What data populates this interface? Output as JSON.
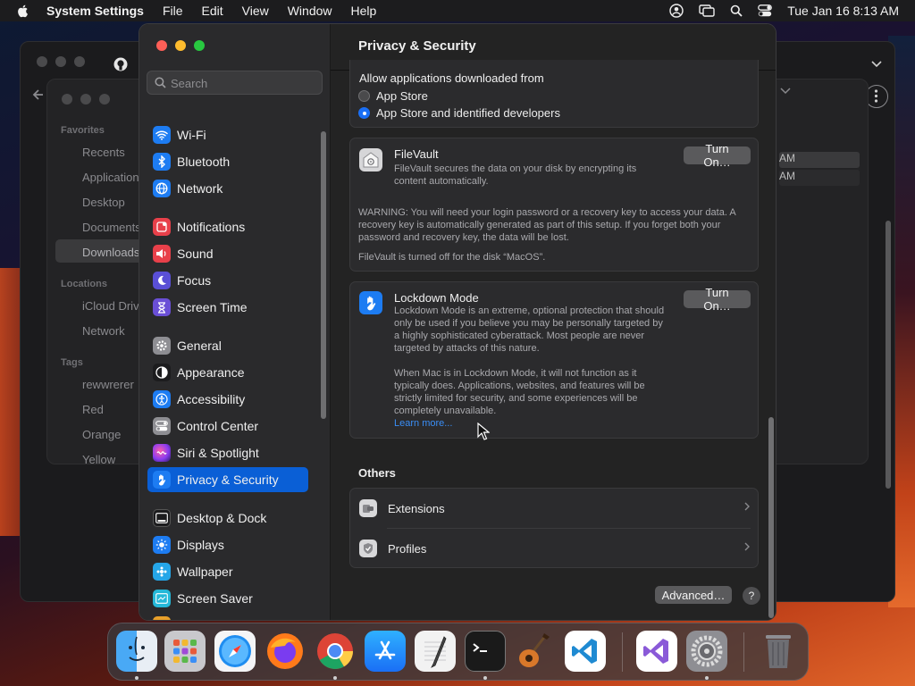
{
  "menubar": {
    "app_name": "System Settings",
    "items": [
      "File",
      "Edit",
      "View",
      "Window",
      "Help"
    ],
    "clock": "Tue Jan 16  8:13 AM"
  },
  "finder": {
    "favorites_header": "Favorites",
    "favorites": [
      "Recents",
      "Applications",
      "Desktop",
      "Documents",
      "Downloads"
    ],
    "locations_header": "Locations",
    "locations": [
      "iCloud Drive",
      "Network"
    ],
    "tags_header": "Tags",
    "tags": [
      "rewwrerer",
      "Red",
      "Orange",
      "Yellow"
    ],
    "right_rows": [
      "AM",
      "AM"
    ]
  },
  "sidebar": {
    "search_placeholder": "Search",
    "items": [
      {
        "label": "Wi-Fi",
        "color": "#1d7cf2",
        "icon": "wifi-icon"
      },
      {
        "label": "Bluetooth",
        "color": "#1d7cf2",
        "icon": "bluetooth-icon"
      },
      {
        "label": "Network",
        "color": "#1d7cf2",
        "icon": "globe-icon"
      },
      {
        "label": "Notifications",
        "color": "#e8404a",
        "icon": "bell-icon"
      },
      {
        "label": "Sound",
        "color": "#e8404a",
        "icon": "speaker-icon"
      },
      {
        "label": "Focus",
        "color": "#5a4fd6",
        "icon": "moon-icon"
      },
      {
        "label": "Screen Time",
        "color": "#6a4fd6",
        "icon": "hourglass-icon"
      },
      {
        "label": "General",
        "color": "#8e8e93",
        "icon": "gear-icon"
      },
      {
        "label": "Appearance",
        "color": "#1c1c1e",
        "icon": "appearance-icon"
      },
      {
        "label": "Accessibility",
        "color": "#1d7cf2",
        "icon": "accessibility-icon"
      },
      {
        "label": "Control Center",
        "color": "#8e8e93",
        "icon": "control-center-icon"
      },
      {
        "label": "Siri & Spotlight",
        "color": "#b03ad8",
        "icon": "siri-icon"
      },
      {
        "label": "Privacy & Security",
        "color": "#1d7cf2",
        "icon": "hand-icon"
      },
      {
        "label": "Desktop & Dock",
        "color": "#1c1c1e",
        "icon": "dock-icon"
      },
      {
        "label": "Displays",
        "color": "#1d7cf2",
        "icon": "sun-icon"
      },
      {
        "label": "Wallpaper",
        "color": "#25a6e8",
        "icon": "wallpaper-icon"
      },
      {
        "label": "Screen Saver",
        "color": "#25b8d8",
        "icon": "screen-saver-icon"
      }
    ],
    "selected_index": 12
  },
  "content": {
    "title": "Privacy & Security",
    "allow": {
      "heading": "Allow applications downloaded from",
      "option1": "App Store",
      "option2": "App Store and identified developers",
      "selected": "App Store and identified developers"
    },
    "filevault": {
      "title": "FileVault",
      "desc": "FileVault secures the data on your disk by encrypting its content automatically.",
      "warning": "WARNING: You will need your login password or a recovery key to access your data. A recovery key is automatically generated as part of this setup. If you forget both your password and recovery key, the data will be lost.",
      "status": "FileVault is turned off for the disk “MacOS”.",
      "button": "Turn On…"
    },
    "lockdown": {
      "title": "Lockdown Mode",
      "desc": "Lockdown Mode is an extreme, optional protection that should only be used if you believe you may be personally targeted by a highly sophisticated cyberattack. Most people are never targeted by attacks of this nature.",
      "desc2": "When Mac is in Lockdown Mode, it will not function as it typically does. Applications, websites, and features will be strictly limited for security, and some experiences will be completely unavailable.",
      "learn_more": "Learn more...",
      "button": "Turn On…"
    },
    "others_header": "Others",
    "others": [
      "Extensions",
      "Profiles"
    ],
    "advanced_button": "Advanced…",
    "help_label": "?"
  },
  "dock": {
    "apps": [
      "Finder",
      "Launchpad",
      "Safari",
      "Firefox",
      "Chrome",
      "App Store",
      "TextEdit",
      "Terminal",
      "GarageBand",
      "Visual Studio Code",
      "Visual Studio",
      "System Settings",
      "Trash"
    ]
  }
}
